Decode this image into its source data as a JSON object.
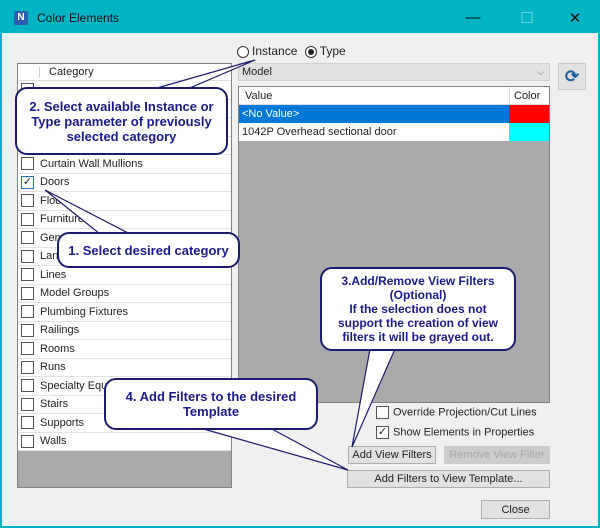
{
  "window": {
    "title": "Color Elements",
    "logo": "N",
    "minimize": "—",
    "maximize": "☐",
    "close": "✕"
  },
  "mode": {
    "instance_label": "Instance",
    "type_label": "Type",
    "selected": "Type"
  },
  "categories": {
    "header": "Category",
    "items": [
      {
        "label": "",
        "checked": false
      },
      {
        "label": "",
        "checked": false
      },
      {
        "label": "",
        "checked": false
      },
      {
        "label": "",
        "checked": false
      },
      {
        "label": "Curtain Wall Mullions",
        "checked": false
      },
      {
        "label": "Doors",
        "checked": true
      },
      {
        "label": "Floo",
        "checked": false
      },
      {
        "label": "Furniture",
        "checked": false
      },
      {
        "label": "Gen",
        "checked": false
      },
      {
        "label": "Lan",
        "checked": false
      },
      {
        "label": "Lines",
        "checked": false
      },
      {
        "label": "Model Groups",
        "checked": false
      },
      {
        "label": "Plumbing Fixtures",
        "checked": false
      },
      {
        "label": "Railings",
        "checked": false
      },
      {
        "label": "Rooms",
        "checked": false
      },
      {
        "label": "Runs",
        "checked": false
      },
      {
        "label": "Specialty Equ",
        "checked": false
      },
      {
        "label": "Stairs",
        "checked": false
      },
      {
        "label": "Supports",
        "checked": false
      },
      {
        "label": "Walls",
        "checked": false
      }
    ]
  },
  "parameter_dropdown": {
    "value": "Model"
  },
  "refresh_icon": "refresh-icon",
  "values_table": {
    "headers": [
      "Value",
      "Color"
    ],
    "rows": [
      {
        "value": "<No Value>",
        "color": "#ff0000",
        "selected": true
      },
      {
        "value": "1042P Overhead sectional door",
        "color": "#00ffff",
        "selected": false
      }
    ]
  },
  "options": {
    "override_label": "Override Projection/Cut Lines",
    "override_checked": false,
    "show_label": "Show Elements in Properties",
    "show_checked": true
  },
  "buttons": {
    "add_view_filters": "Add View Filters",
    "remove_view_filter": "Remove View Filter",
    "add_to_template": "Add Filters to View Template...",
    "close": "Close"
  },
  "callouts": {
    "c1": "1. Select desired category",
    "c2": "2. Select available Instance or Type parameter of previously selected category",
    "c3a": "3.Add/Remove View Filters (Optional)",
    "c3b": "If the selection does not support the creation of view filters it will be grayed out.",
    "c4": "4. Add Filters to the desired Template"
  },
  "colors": {
    "titlebar": "#00b4c4",
    "selection": "#0078d7",
    "callout_text": "#1a1a8c"
  }
}
